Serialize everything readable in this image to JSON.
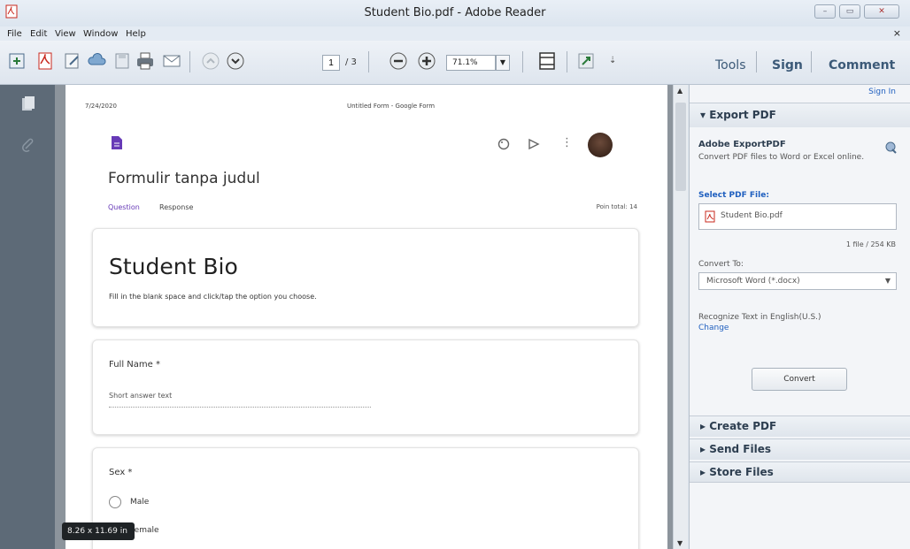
{
  "window": {
    "title": "Student Bio.pdf - Adobe Reader",
    "close_doc": "×"
  },
  "menu": [
    "File",
    "Edit",
    "View",
    "Window",
    "Help"
  ],
  "toolbar": {
    "page_current": "1",
    "page_total": "/ 3",
    "zoom": "71.1%",
    "tabs": [
      "Tools",
      "Sign",
      "Comment"
    ]
  },
  "document": {
    "header_date": "7/24/2020",
    "header_title": "Untitled Form - Google Form",
    "form_title": "Formulir tanpa judul",
    "tab_question": "Question",
    "tab_response": "Response",
    "points": "Poin total: 14",
    "bio_title": "Student Bio",
    "bio_desc": "Fill in the blank space and click/tap the option you choose.",
    "q1_label": "Full Name *",
    "q1_placeholder": "Short answer text",
    "q2_label": "Sex *",
    "q2_option1": "Male",
    "q2_option2": "Female"
  },
  "panel": {
    "sign_in": "Sign In",
    "export_header": "Export PDF",
    "adobe_title": "Adobe ExportPDF",
    "adobe_desc": "Convert PDF files to Word or Excel online.",
    "select_label": "Select PDF File:",
    "file_name": "Student Bio.pdf",
    "file_count": "1 file / 254 KB",
    "convert_label": "Convert To:",
    "convert_value": "Microsoft Word (*.docx)",
    "recognize": "Recognize Text in English(U.S.)",
    "change": "Change",
    "convert_button": "Convert",
    "create_pdf": "Create PDF",
    "send_files": "Send Files",
    "store_files": "Store Files"
  },
  "status": {
    "page_size": "8.26 x 11.69 in"
  },
  "colors": {
    "accent": "#673ab7",
    "link": "#1f5fbf",
    "pdf_red": "#c8281e"
  }
}
